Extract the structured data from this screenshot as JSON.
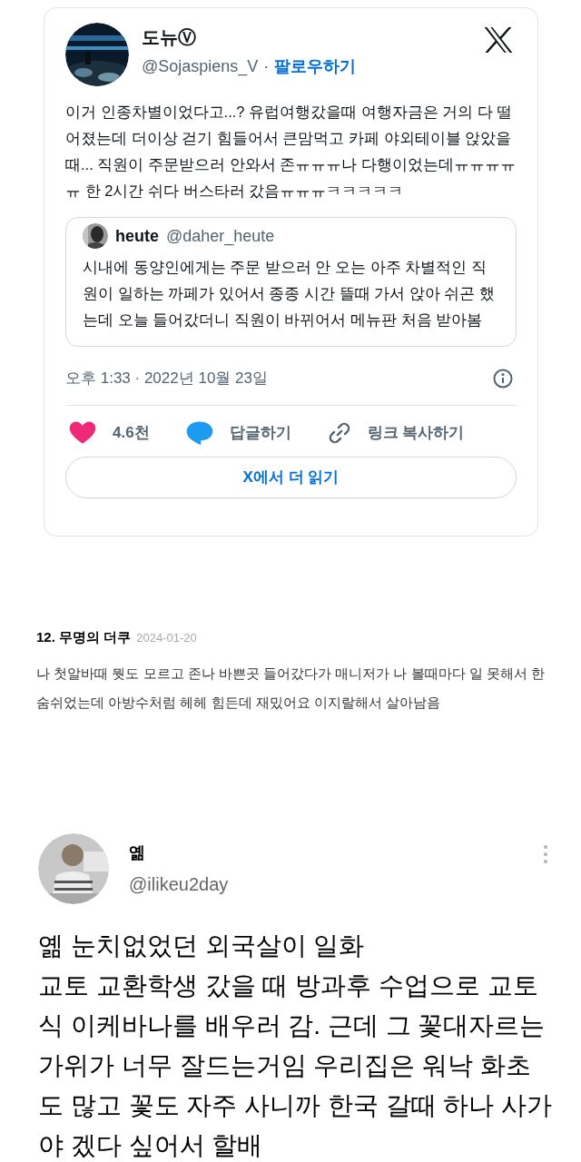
{
  "embed_tweet": {
    "name": "도뉴Ⓥ",
    "handle": "@Sojaspiens_V",
    "separator": "·",
    "follow": "팔로우하기",
    "text": "이거 인종차별이었다고...? 유럽여행갔을때 여행자금은 거의 다 떨어졌는데 더이상 걷기 힘들어서 큰맘먹고 카페 야외테이블 앉았을때... 직원이 주문받으러 안와서 존ㅠㅠㅠ나 다행이었는데ㅠㅠㅠㅠㅠ 한 2시간 쉬다 버스타러 갔음ㅠㅠㅠㅋㅋㅋㅋㅋ",
    "quote": {
      "name": "heute",
      "handle": "@daher_heute",
      "text": "시내에 동양인에게는 주문 받으러 안 오는 아주 차별적인 직원이 일하는 까페가 있어서 종종 시간 뜰때 가서 앉아 쉬곤 했는데 오늘 들어갔더니 직원이 바뀌어서 메뉴판 처음 받아봄"
    },
    "timestamp": "오후 1:33 · 2022년 10월 23일",
    "actions": [
      {
        "kind": "like",
        "label": "4.6천"
      },
      {
        "kind": "reply",
        "label": "답글하기"
      },
      {
        "kind": "link",
        "label": "링크 복사하기"
      }
    ],
    "read_more": "X에서 더 읽기"
  },
  "comment": {
    "number": "12.",
    "author": "무명의 더쿠",
    "date": "2024-01-20",
    "text": "나 첫알바때 뭣도 모르고 존나 바쁜곳 들어갔다가 매니저가 나 볼때마다 일 못해서 한숨쉬었는데 아방수처럼 헤헤 힘든데 재밌어요 이지랄해서 살아남음"
  },
  "tweet": {
    "name": "옒",
    "handle": "@ilikeu2day",
    "lines": [
      "옒 눈치없었던 외국살이 일화",
      "교토 교환학생 갔을 때 방과후 수업으로 교토식 이케바나를 배우러 감. 근데 그 꽃대자르는 가위가 너무 잘드는거임 우리집은 워낙 화초도 많고 꽃도 자주 사니까 한국 갈때 하나 사가야 겠다 싶어서 할배"
    ]
  }
}
